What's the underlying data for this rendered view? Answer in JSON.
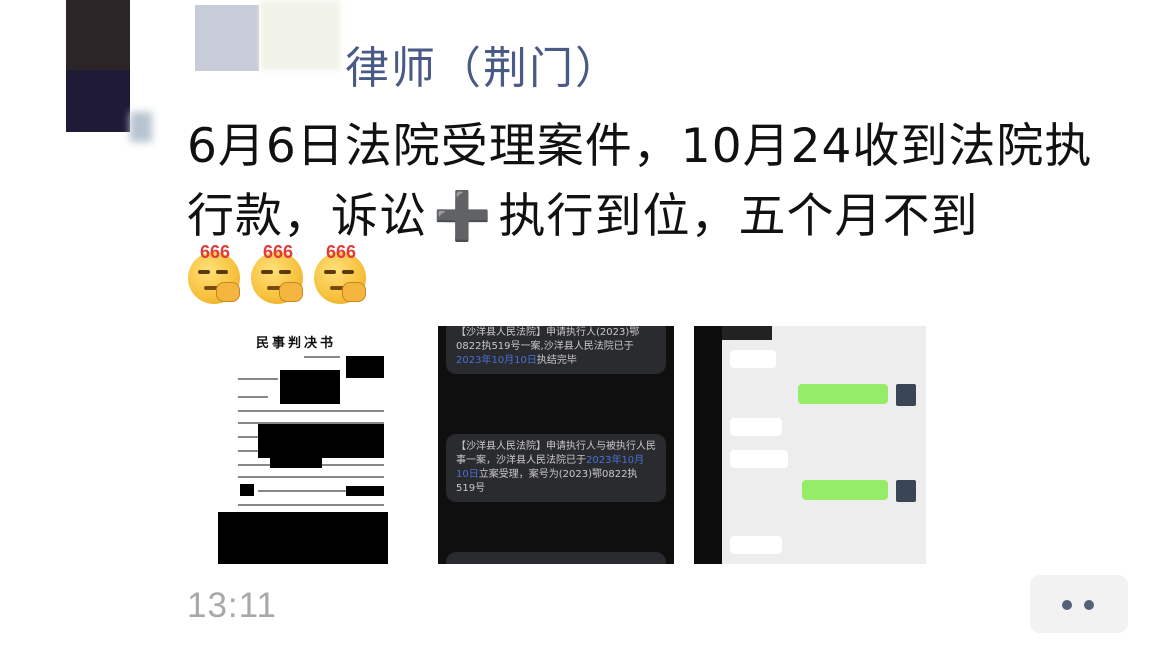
{
  "post": {
    "author_name": "律师（荆门）",
    "message_part1": "6月6日法院受理案件，10月24收到法院执行款，诉讼",
    "plus_symbol": "➕",
    "message_part2": "执行到位，五个月不到",
    "emojis": [
      {
        "icon": "666-thinking-emoji",
        "label": "666"
      },
      {
        "icon": "666-thinking-emoji",
        "label": "666"
      },
      {
        "icon": "666-thinking-emoji",
        "label": "666"
      }
    ],
    "time": "13:11"
  },
  "images": {
    "doc": {
      "title": "民事判决书"
    },
    "sms": {
      "bubble1_prefix": "【沙洋县人民法院】申请执行人(2023)鄂0822执519号一案,沙洋县人民法院已于",
      "bubble1_date": "2023年10月10日",
      "bubble1_suffix": "执结完毕",
      "bubble2_prefix": "【沙洋县人民法院】申请执行人与被执行人民事一案，沙洋县人民法院已于",
      "bubble2_date": "2023年10月10日",
      "bubble2_suffix": "立案受理，案号为(2023)鄂0822执519号"
    }
  },
  "colors": {
    "author": "#4a5a86",
    "timestamp": "#a8a8a8",
    "wechat_green": "#95ec69"
  }
}
